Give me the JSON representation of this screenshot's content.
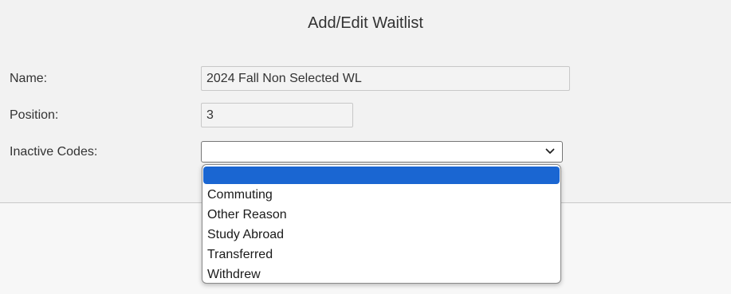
{
  "dialog": {
    "title": "Add/Edit Waitlist"
  },
  "form": {
    "name_label": "Name:",
    "name_value": "2024 Fall Non Selected WL",
    "position_label": "Position:",
    "position_value": "3",
    "inactive_codes_label": "Inactive Codes:",
    "inactive_codes_selected": ""
  },
  "dropdown": {
    "options": [
      {
        "label": "",
        "selected": true
      },
      {
        "label": "Commuting",
        "selected": false
      },
      {
        "label": "Other Reason",
        "selected": false
      },
      {
        "label": "Study Abroad",
        "selected": false
      },
      {
        "label": "Transferred",
        "selected": false
      },
      {
        "label": "Withdrew",
        "selected": false
      }
    ]
  },
  "icons": {
    "select_arrow": "chevron-down-icon"
  },
  "colors": {
    "selected_option_bg": "#1a66d2",
    "background": "#f2f2f2"
  }
}
